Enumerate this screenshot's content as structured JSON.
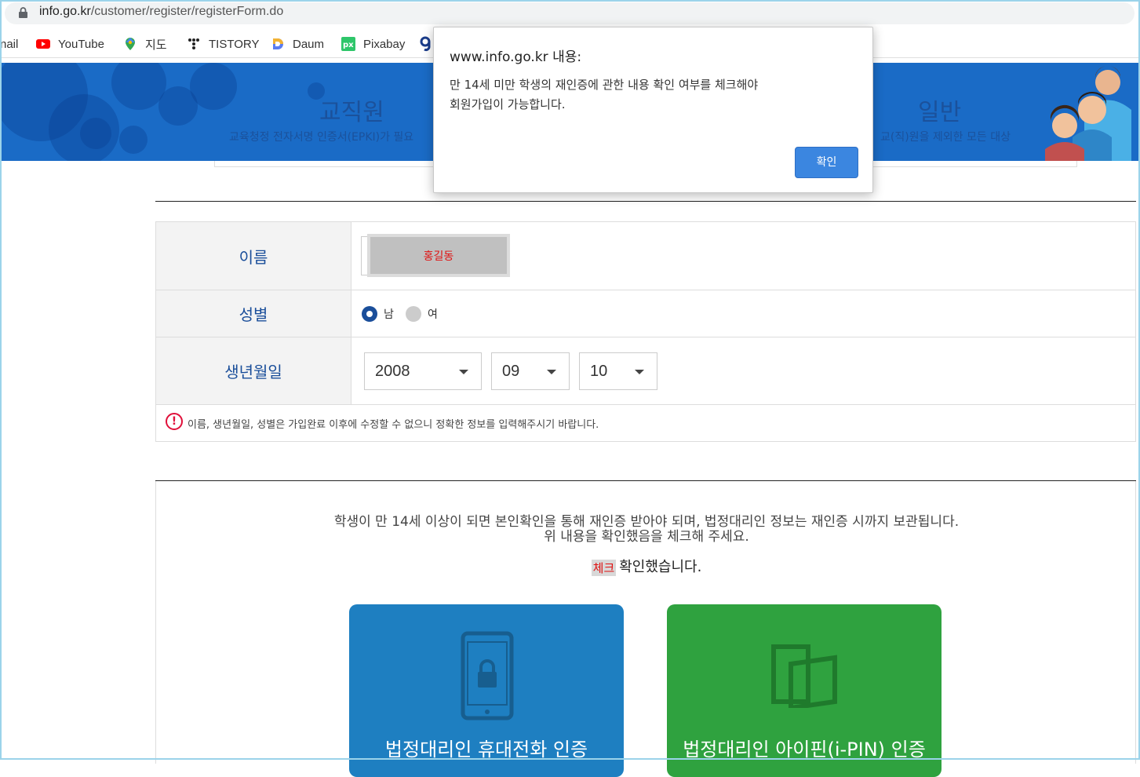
{
  "browser": {
    "url_host": "info.go.kr",
    "url_path": "/customer/register/registerForm.do",
    "bookmarks": [
      {
        "label": "nail",
        "icon": "gmail-icon"
      },
      {
        "label": "YouTube",
        "icon": "youtube-icon"
      },
      {
        "label": "지도",
        "icon": "google-maps-icon"
      },
      {
        "label": "TISTORY",
        "icon": "tistory-icon"
      },
      {
        "label": "Daum",
        "icon": "daum-icon"
      },
      {
        "label": "Pixabay",
        "icon": "pixabay-icon"
      }
    ]
  },
  "banner": {
    "left_title": "교직원",
    "left_sub": "교육청정 전자서명 인증서(EPKI)가 필요",
    "right_title": "일반",
    "right_sub": "교(직)원을 제외한 모든 대상"
  },
  "form": {
    "name_label": "이름",
    "name_value": "홍길동",
    "gender_label": "성별",
    "gender_options": [
      "남",
      "여"
    ],
    "gender_selected": "남",
    "birth_label": "생년월일",
    "birth_year": "2008",
    "birth_month": "09",
    "birth_day": "10",
    "notice": "이름, 생년월일, 성별은 가입완료 이후에 수정할 수 없으니 정확한 정보를 입력해주시기 바랍니다."
  },
  "guardian": {
    "line1": "학생이 만 14세 이상이 되면 본인확인을 통해 재인증 받아야 되며, 법정대리인 정보는 재인증 시까지 보관됩니다.",
    "line2": "위 내용을 확인했음을 체크해 주세요.",
    "check_mask": "체크",
    "check_label": "확인했습니다.",
    "phone_button": "법정대리인 휴대전화 인증",
    "ipin_button": "법정대리인 아이핀(i-PIN) 인증",
    "phone_color": "#1e7fc1",
    "ipin_color": "#2fa23f"
  },
  "dialog": {
    "title": "www.info.go.kr 내용:",
    "message_line1": "만 14세 미만 학생의 재인증에 관한 내용 확인 여부를 체크해야",
    "message_line2": "회원가입이 가능합니다.",
    "ok_label": "확인",
    "ok_color": "#3b86e0"
  }
}
